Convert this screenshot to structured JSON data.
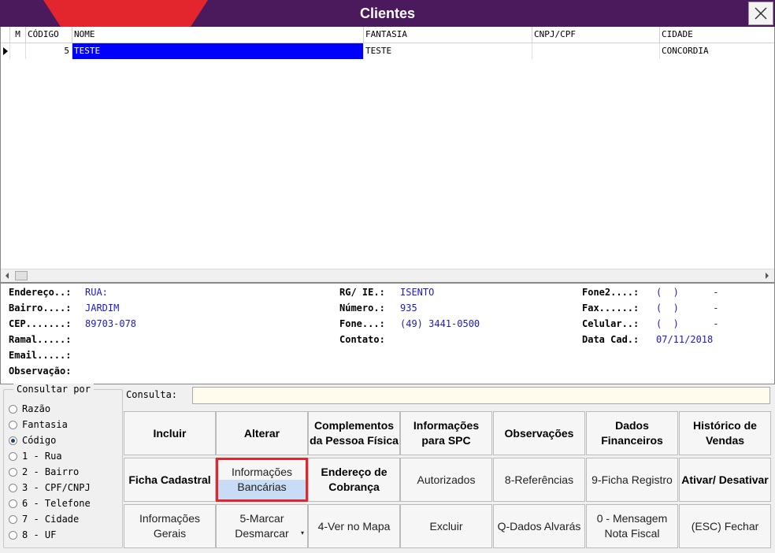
{
  "window": {
    "title": "Clientes"
  },
  "grid": {
    "columns": [
      "M",
      "CÓDIGO",
      "NOME",
      "FANTASIA",
      "CNPJ/CPF",
      "CIDADE"
    ],
    "rows": [
      {
        "m": "",
        "codigo": "5",
        "nome": "TESTE",
        "fantasia": "TESTE",
        "cnpj": "",
        "cidade": "CONCORDIA"
      }
    ]
  },
  "details": {
    "endereco_label": "Endereço..:",
    "endereco": "RUA:",
    "bairro_label": "Bairro....:",
    "bairro": "JARDIM",
    "cep_label": "CEP.......:",
    "cep": "89703-078",
    "ramal_label": "Ramal.....:",
    "ramal": "",
    "email_label": "Email.....:",
    "email": "",
    "obs_label": "Observação:",
    "obs": "",
    "rg_label": "RG/ IE.:",
    "rg": "ISENTO",
    "numero_label": "Número.:",
    "numero": "935",
    "fone_label": "Fone...:",
    "fone": "(49) 3441-0500",
    "contato_label": "Contato:",
    "contato": "",
    "fone2_label": "Fone2....:",
    "fone2": "(  )      -",
    "fax_label": "Fax......:",
    "fax": "(  )      -",
    "celular_label": "Celular..:",
    "celular": "(  )      -",
    "datacad_label": "Data Cad.:",
    "datacad": "07/11/2018"
  },
  "search": {
    "group_label": "Consultar por",
    "options": [
      "Razão",
      "Fantasia",
      "Código",
      "1 - Rua",
      "2 - Bairro",
      "3 - CPF/CNPJ",
      "6 - Telefone",
      "7 - Cidade",
      "8 - UF"
    ],
    "selected": "Código",
    "consulta_label": "Consulta:",
    "consulta_value": ""
  },
  "buttons": {
    "incluir": "Incluir",
    "alterar": "Alterar",
    "complementos": "Complementos da Pessoa Física",
    "info_spc": "Informações para SPC",
    "observacoes": "Observações",
    "dados_fin": "Dados Financeiros",
    "hist_vendas": "Histórico de Vendas",
    "ficha_cad": "Ficha Cadastral",
    "info_banc_1": "Informações",
    "info_banc_2": "Bancárias",
    "end_cobranca": "Endereço de Cobrança",
    "autorizados": "Autorizados",
    "referencias": "8-Referências",
    "ficha_reg": "9-Ficha Registro",
    "ativar": "Ativar/ Desativar",
    "info_gerais": "Informações Gerais",
    "marcar": "5-Marcar Desmarcar",
    "ver_mapa": "4-Ver no Mapa",
    "excluir": "Excluir",
    "dados_alvaras": "Q-Dados Alvarás",
    "mensagem_nf": "0 - Mensagem Nota Fiscal",
    "fechar": "(ESC) Fechar"
  },
  "colors": {
    "titlebar": "#4a1a5c",
    "accent": "#e3262e",
    "selection": "#0000ff",
    "value_text": "#1a1acc"
  }
}
